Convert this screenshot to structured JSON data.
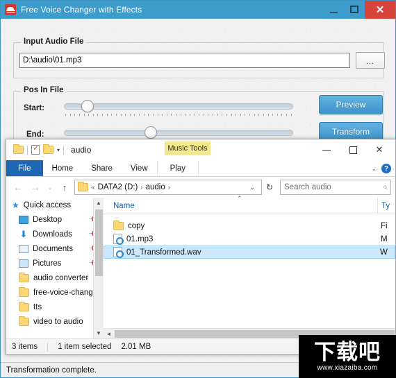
{
  "app": {
    "title": "Free Voice Changer with Effects",
    "icon": "voice-changer-icon",
    "window_controls": {
      "minimize": "—",
      "maximize": "□",
      "close": "✕"
    },
    "input_group": {
      "legend": "Input Audio File",
      "path_value": "D:\\audio\\01.mp3",
      "browse_label": "..."
    },
    "pos_group": {
      "legend": "Pos In File",
      "start_label": "Start:",
      "end_label": "End:",
      "start_percent": 13,
      "end_percent": 35
    },
    "buttons": {
      "preview": "Preview",
      "transform": "Transform"
    },
    "status": "Transformation complete."
  },
  "explorer": {
    "window_title": "audio",
    "quick_access_toolbar": [
      "folder-icon",
      "properties-icon",
      "new-folder-icon",
      "customize-caret-icon"
    ],
    "contextual_tab_header": "Music Tools",
    "window_controls": {
      "minimize": "—",
      "maximize": "□",
      "close": "✕"
    },
    "ribbon_tabs": [
      {
        "label": "File",
        "active": true
      },
      {
        "label": "Home",
        "active": false
      },
      {
        "label": "Share",
        "active": false
      },
      {
        "label": "View",
        "active": false
      },
      {
        "label": "Play",
        "active": false
      }
    ],
    "ribbon_right": {
      "collapse": "⌄",
      "help": "?"
    },
    "navbar": {
      "back": "←",
      "forward": "→",
      "recent": "⌄",
      "up": "↑",
      "breadcrumb": [
        "«",
        "DATA2 (D:)",
        "›",
        "audio",
        "›"
      ],
      "address_caret": "⌄",
      "refresh": "↻",
      "search_placeholder": "Search audio",
      "search_icon": "search-icon"
    },
    "nav_pane": [
      {
        "label": "Quick access",
        "icon": "star-icon",
        "pinned": false,
        "root": true
      },
      {
        "label": "Desktop",
        "icon": "desktop-icon",
        "pinned": true
      },
      {
        "label": "Downloads",
        "icon": "download-icon",
        "pinned": true
      },
      {
        "label": "Documents",
        "icon": "documents-icon",
        "pinned": true
      },
      {
        "label": "Pictures",
        "icon": "pictures-icon",
        "pinned": true
      },
      {
        "label": "audio converter",
        "icon": "folder-icon",
        "pinned": false
      },
      {
        "label": "free-voice-chang",
        "icon": "folder-icon",
        "pinned": false
      },
      {
        "label": "tts",
        "icon": "folder-icon",
        "pinned": false
      },
      {
        "label": "video to audio",
        "icon": "folder-icon",
        "pinned": false
      }
    ],
    "columns": {
      "name": "Name",
      "type": "Ty"
    },
    "files": [
      {
        "name": "copy",
        "icon": "folder-icon",
        "type": "Fi",
        "selected": false
      },
      {
        "name": "01.mp3",
        "icon": "media-file-icon",
        "type": "M",
        "selected": false
      },
      {
        "name": "01_Transformed.wav",
        "icon": "media-file-icon",
        "type": "W",
        "selected": true
      }
    ],
    "status_bar": {
      "item_count": "3 items",
      "selection": "1 item selected",
      "size": "2.01 MB"
    }
  },
  "watermark": {
    "text": "下载吧",
    "url": "www.xiazaiba.com"
  }
}
